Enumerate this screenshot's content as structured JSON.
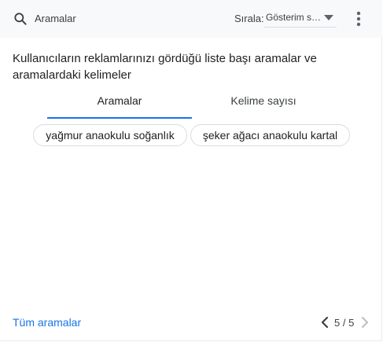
{
  "header": {
    "search_label": "Aramalar",
    "sort_label": "Sırala:",
    "sort_value": "Gösterim sayısı"
  },
  "heading": "Kullanıcıların reklamlarınızı gördüğü liste başı aramalar ve aramalardaki kelimeler",
  "tabs": [
    {
      "label": "Aramalar",
      "active": true
    },
    {
      "label": "Kelime sayısı",
      "active": false
    }
  ],
  "chips": [
    {
      "label": "yağmur anaokulu soğanlık"
    },
    {
      "label": "şeker ağacı anaokulu kartal"
    }
  ],
  "footer": {
    "link_label": "Tüm aramalar",
    "page_indicator": "5 / 5"
  },
  "icons": {
    "search": "search-icon",
    "dropdown": "dropdown-arrow-icon",
    "more": "more-vert-icon",
    "prev": "chevron-left-icon",
    "next": "chevron-right-icon"
  },
  "colors": {
    "accent": "#1a73e8",
    "header_bg": "#f8f9fa",
    "disabled": "#bdc1c6"
  }
}
